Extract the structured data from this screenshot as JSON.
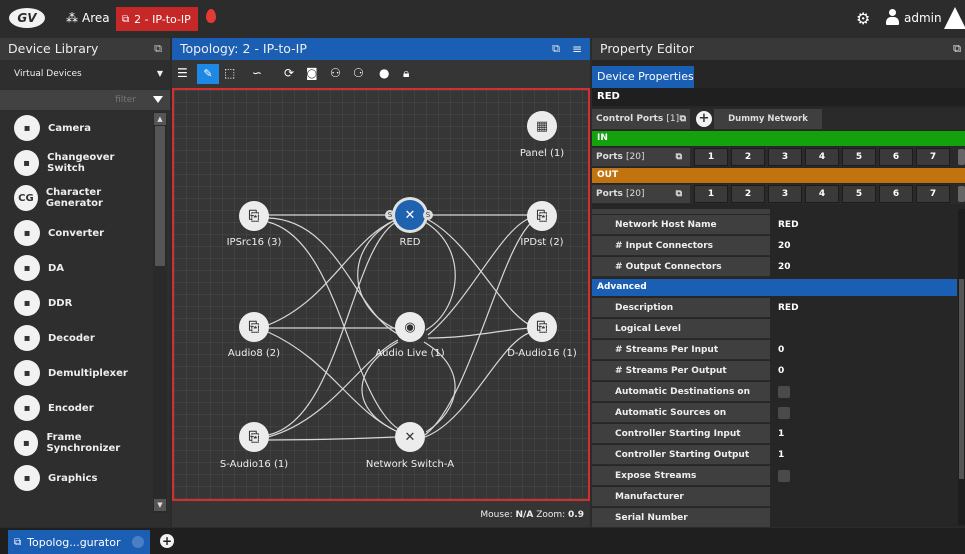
{
  "topbar": {
    "area_label": "Area",
    "active_tab_label": "2 - IP-to-IP",
    "user_label": "admin"
  },
  "library": {
    "title": "Device Library",
    "dropdown_value": "Virtual Devices",
    "filter_placeholder": "filter",
    "items": [
      {
        "label": "Camera",
        "icon": "camera-icon"
      },
      {
        "label": "Changeover Switch",
        "icon": "changeover-icon"
      },
      {
        "label": "Character Generator",
        "icon": "cg-icon",
        "glyph": "CG"
      },
      {
        "label": "Converter",
        "icon": "converter-icon"
      },
      {
        "label": "DA",
        "icon": "da-icon"
      },
      {
        "label": "DDR",
        "icon": "ddr-icon"
      },
      {
        "label": "Decoder",
        "icon": "decoder-icon"
      },
      {
        "label": "Demultiplexer",
        "icon": "demux-icon"
      },
      {
        "label": "Encoder",
        "icon": "encoder-icon"
      },
      {
        "label": "Frame Synchronizer",
        "icon": "framesync-icon"
      },
      {
        "label": "Graphics",
        "icon": "graphics-icon"
      }
    ]
  },
  "topology": {
    "title": "Topology: 2 - IP-to-IP",
    "mouse_label": "Mouse:",
    "mouse_value": "N/A",
    "zoom_label": "Zoom:",
    "zoom_value": "0.9",
    "nodes": {
      "ipsrc": "IPSrc16 (3)",
      "audio8": "Audio8 (2)",
      "saudio": "S-Audio16 (1)",
      "red": "RED",
      "audiolive": "Audio Live (1)",
      "nswa": "Network Switch-A",
      "panel": "Panel (1)",
      "ipdst": "IPDst (2)",
      "daudio": "D-Audio16 (1)"
    }
  },
  "property": {
    "title": "Property Editor",
    "tab": "Device Properties",
    "device_name": "RED",
    "control_ports_label": "Control Ports",
    "control_ports_count": "[1]",
    "dummy_switch_label": "Dummy Network Switch",
    "in_label": "IN",
    "out_label": "OUT",
    "ports_label": "Ports",
    "ports_count": "[20]",
    "port_numbers": [
      "1",
      "2",
      "3",
      "4",
      "5",
      "6",
      "7"
    ],
    "basic_rows": [
      {
        "label": "Network Host Name",
        "value": "RED"
      },
      {
        "label": "# Input Connectors",
        "value": "20"
      },
      {
        "label": "# Output Connectors",
        "value": "20"
      }
    ],
    "advanced_label": "Advanced",
    "advanced_rows": [
      {
        "label": "Description",
        "value": "RED"
      },
      {
        "label": "Logical Level",
        "value": ""
      },
      {
        "label": "# Streams Per Input",
        "value": "0"
      },
      {
        "label": "# Streams Per Output",
        "value": "0"
      },
      {
        "label": "Automatic Destinations on Inputs",
        "value": "",
        "checkbox": true
      },
      {
        "label": "Automatic Sources on Outputs",
        "value": "",
        "checkbox": true
      },
      {
        "label": "Controller Starting Input",
        "value": "1"
      },
      {
        "label": "Controller Starting Output",
        "value": "1"
      },
      {
        "label": "Expose Streams",
        "value": "",
        "checkbox": true
      },
      {
        "label": "Manufacturer",
        "value": ""
      },
      {
        "label": "Serial Number",
        "value": ""
      }
    ]
  },
  "bottom": {
    "tab_label": "Topolog...gurator"
  },
  "colors": {
    "accent_blue": "#1a5fb4",
    "active_red": "#c62828",
    "in_green": "#13a10e",
    "out_orange": "#c0730e"
  }
}
